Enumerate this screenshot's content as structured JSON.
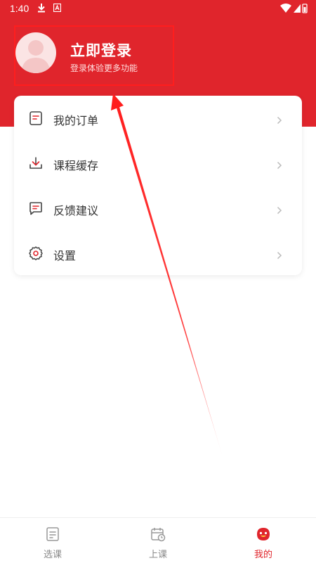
{
  "status_bar": {
    "time": "1:40"
  },
  "profile": {
    "title": "立即登录",
    "subtitle": "登录体验更多功能"
  },
  "menu": {
    "items": [
      {
        "label": "我的订单",
        "icon": "order-icon"
      },
      {
        "label": "课程缓存",
        "icon": "download-icon"
      },
      {
        "label": "反馈建议",
        "icon": "feedback-icon"
      },
      {
        "label": "设置",
        "icon": "settings-icon"
      }
    ]
  },
  "tabbar": {
    "tabs": [
      {
        "label": "选课",
        "icon": "course-select-icon",
        "active": false
      },
      {
        "label": "上课",
        "icon": "calendar-clock-icon",
        "active": false
      },
      {
        "label": "我的",
        "icon": "profile-icon",
        "active": true
      }
    ]
  },
  "colors": {
    "brand_red": "#e0252c",
    "annotation_red": "#ff1e1e",
    "text_primary": "#333333",
    "text_muted": "#888888"
  }
}
